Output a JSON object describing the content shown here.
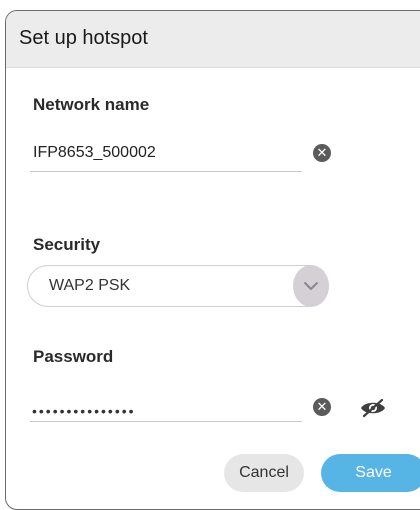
{
  "dialog": {
    "title": "Set up hotspot"
  },
  "network": {
    "label": "Network name",
    "value": "IFP8653_500002",
    "clear_icon": "close-icon"
  },
  "security": {
    "label": "Security",
    "selected": "WAP2 PSK",
    "dropdown_icon": "chevron-down-icon"
  },
  "password": {
    "label": "Password",
    "masked_value": "•••••••••••••••",
    "clear_icon": "close-icon",
    "visibility_icon": "eye-off-icon"
  },
  "actions": {
    "cancel_label": "Cancel",
    "save_label": "Save"
  },
  "colors": {
    "primary": "#57b5e6",
    "title_bar": "#ececec",
    "dropdown_circle": "#d4d0d6"
  }
}
